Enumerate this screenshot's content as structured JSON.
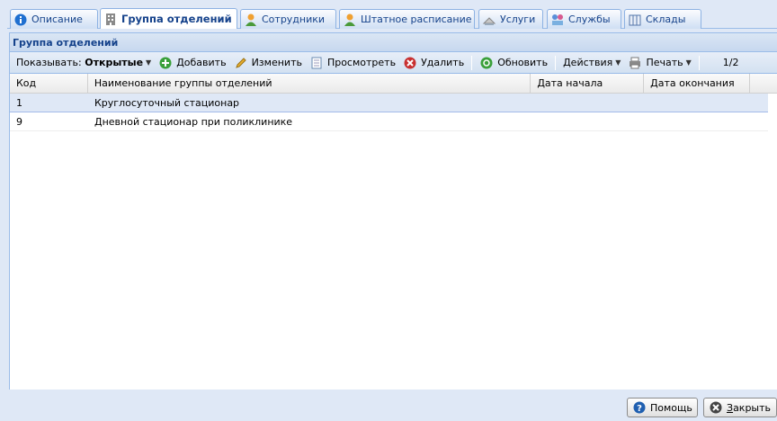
{
  "tabs": [
    {
      "label": "Описание",
      "icon": "info-icon",
      "active": false
    },
    {
      "label": "Группа отделений",
      "icon": "building-icon",
      "active": true
    },
    {
      "label": "Сотрудники",
      "icon": "user-icon",
      "active": false
    },
    {
      "label": "Штатное расписание",
      "icon": "user-icon",
      "active": false
    },
    {
      "label": "Услуги",
      "icon": "services-icon",
      "active": false
    },
    {
      "label": "Службы",
      "icon": "group-icon",
      "active": false
    },
    {
      "label": "Склады",
      "icon": "warehouse-icon",
      "active": false
    }
  ],
  "panel": {
    "title": "Группа отделений"
  },
  "toolbar": {
    "show_label": "Показывать:",
    "show_value": "Открытые",
    "add": "Добавить",
    "edit": "Изменить",
    "view": "Просмотреть",
    "delete": "Удалить",
    "refresh": "Обновить",
    "actions": "Действия",
    "print": "Печать",
    "paging": "1/2"
  },
  "grid": {
    "columns": [
      "Код",
      "Наименование группы отделений",
      "Дата начала",
      "Дата окончания"
    ],
    "rows": [
      {
        "code": "1",
        "name": "Круглосуточный стационар",
        "start": "",
        "end": ""
      },
      {
        "code": "9",
        "name": "Дневной стационар при поликлинике",
        "start": "",
        "end": ""
      }
    ]
  },
  "footer": {
    "help": "Помощь",
    "close_first": "З",
    "close_rest": "акрыть"
  },
  "colors": {
    "accent": "#15428b",
    "border": "#99bbe8",
    "selected_row": "#dfe8f6"
  }
}
